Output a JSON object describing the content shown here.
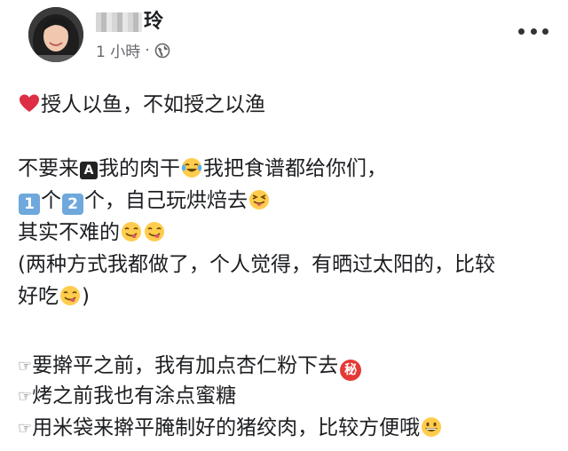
{
  "post": {
    "author_visible_char": "玲",
    "time": "1 小時",
    "separator": "·",
    "privacy_icon": "globe-icon",
    "more_icon": "ellipsis-icon"
  },
  "content": {
    "line1": "授人以鱼，不如授之以渔",
    "line2a": "不要来",
    "line2_letter": "A",
    "line2b": "我的肉干",
    "line2c": "我把食谱都给你们，",
    "line3_key1": "1",
    "line3a": "个",
    "line3_key2": "2",
    "line3b": "个，自己玩烘焙去",
    "line4": "其实不难的",
    "line5": "(两种方式我都做了，个人觉得，有晒过太阳的，比较",
    "line6": "好吃",
    "line6_end": ")",
    "hand_glyph": "☞",
    "tip1": "要擀平之前，我有加点杏仁粉下去",
    "secret_badge": "秘",
    "tip2": "烤之前我也有涂点蜜糖",
    "tip3": "用米袋来擀平腌制好的猪绞肉，比较方便哦"
  },
  "colors": {
    "text": "#1c1e21",
    "meta": "#65676b",
    "heart": "#dd2e44",
    "keycap": "#6fa8dc",
    "secret": "#e53935",
    "emoji_face": "#ffcc4d"
  }
}
